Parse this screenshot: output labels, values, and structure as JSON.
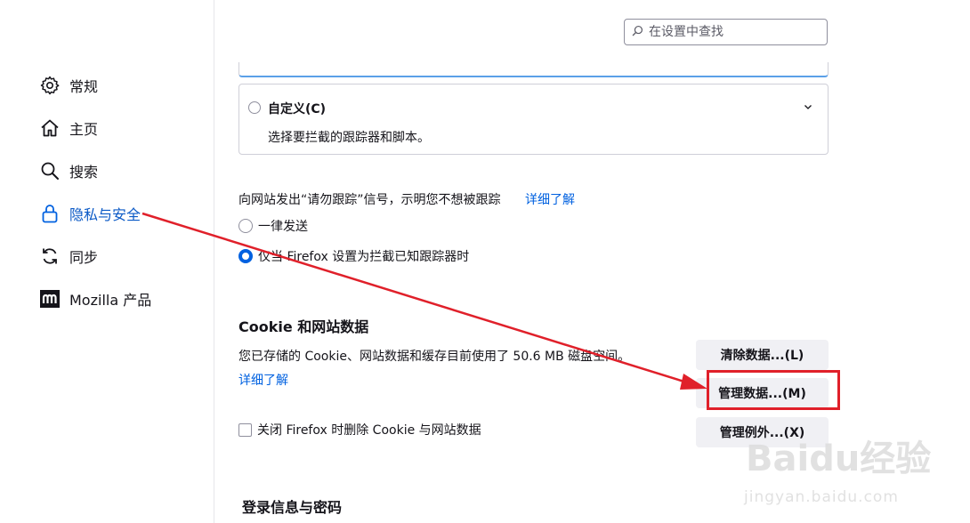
{
  "search": {
    "placeholder": "在设置中查找"
  },
  "sidebar": {
    "items": [
      {
        "label": "常规",
        "icon": "gear-icon"
      },
      {
        "label": "主页",
        "icon": "home-icon"
      },
      {
        "label": "搜索",
        "icon": "search-icon"
      },
      {
        "label": "隐私与安全",
        "icon": "lock-icon",
        "active": true
      },
      {
        "label": "同步",
        "icon": "sync-icon"
      },
      {
        "label": "Mozilla 产品",
        "icon": "mozilla-icon"
      }
    ]
  },
  "tracking": {
    "custom_title": "自定义(C)",
    "custom_desc": "选择要拦截的跟踪器和脚本。",
    "dnt_text": "向网站发出“请勿跟踪”信号，示明您不想被跟踪",
    "dnt_link": "详细了解",
    "option_always": "一律发送",
    "option_only": "仅当 Firefox 设置为拦截已知跟踪器时",
    "selected_option": "option_only"
  },
  "cookies": {
    "title": "Cookie 和网站数据",
    "desc": "您已存储的 Cookie、网站数据和缓存目前使用了 50.6 MB 磁盘空间。",
    "learn_more": "详细了解",
    "clear_button": "清除数据...(L)",
    "manage_button": "管理数据...(M)",
    "exceptions_button": "管理例外...(X)",
    "delete_on_close": "关闭 Firefox 时删除 Cookie 与网站数据",
    "delete_on_close_checked": false
  },
  "logins": {
    "title": "登录信息与密码"
  },
  "annotation": {
    "color": "#e0202a"
  },
  "watermark": {
    "brand": "Baidu经验",
    "url": "jingyan.baidu.com"
  },
  "colors": {
    "accent": "#0061e0",
    "link": "#0061e0",
    "button_bg": "#f0f0f4"
  }
}
